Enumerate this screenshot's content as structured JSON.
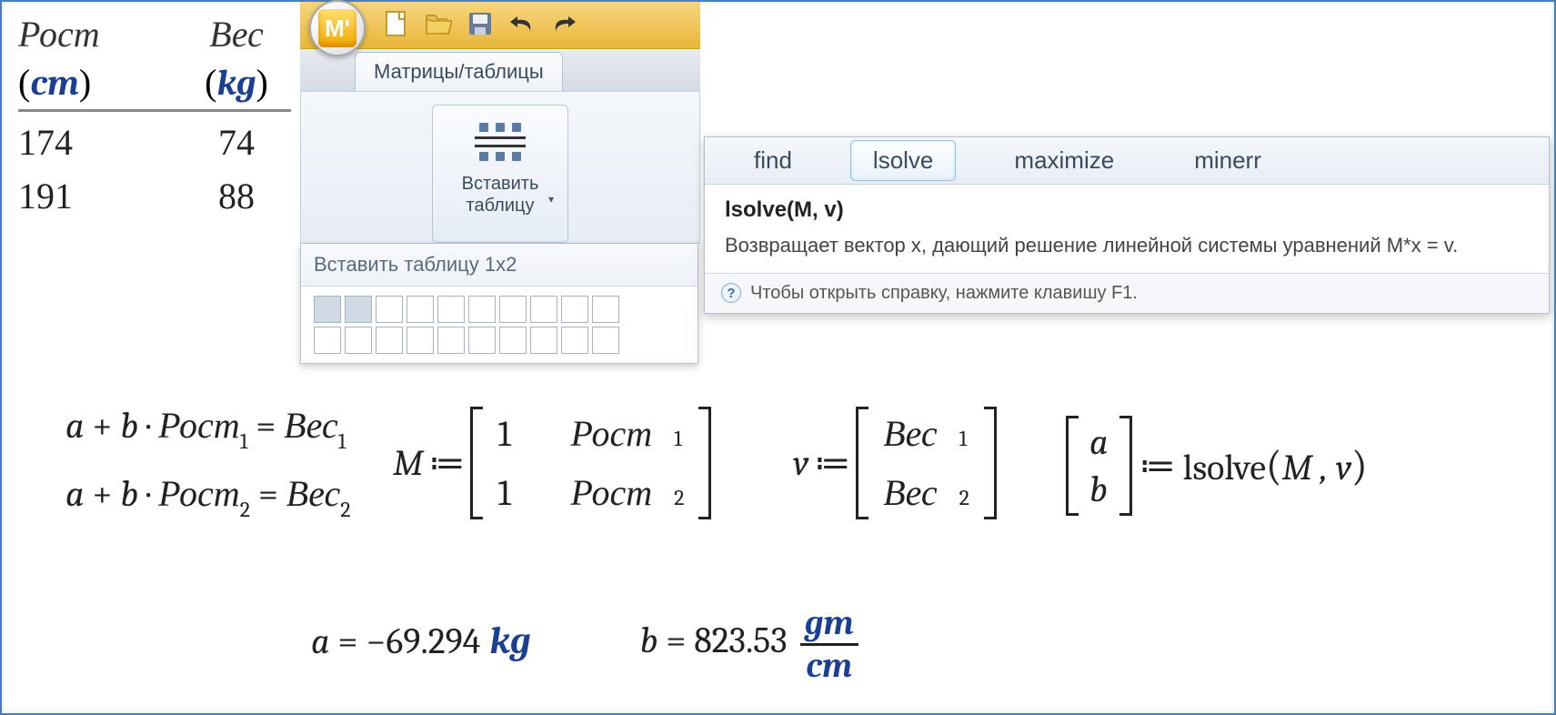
{
  "table": {
    "headers": [
      "Рост",
      "Вес"
    ],
    "units": [
      "cm",
      "kg"
    ],
    "rows": [
      [
        "174",
        "74"
      ],
      [
        "191",
        "88"
      ]
    ]
  },
  "ribbon": {
    "orb_letter": "M'",
    "tab_label": "Матрицы/таблицы",
    "insert_table_button": "Вставить таблицу",
    "insert_popup_title": "Вставить таблицу 1x2"
  },
  "help": {
    "tabs": [
      "find",
      "lsolve",
      "maximize",
      "minerr"
    ],
    "selected": "lsolve",
    "signature": "lsolve(M, v)",
    "description": "Возвращает вектор x, дающий решение линейной системы уравнений M*x = v.",
    "footer": "Чтобы открыть справку, нажмите клавишу F1."
  },
  "equations": {
    "line1_pre": "a + b · ",
    "var_height": "Рост",
    "eq": " = ",
    "var_weight": "Вес",
    "M_label": "M",
    "assign": " ≔ ",
    "v_label": "v",
    "ab_a": "a",
    "ab_b": "b",
    "lsolve_call": "lsolve",
    "lsolve_args": "M , v",
    "one": "1"
  },
  "results": {
    "a_label": "a",
    "a_val": "−69.294",
    "a_unit": "kg",
    "b_label": "b",
    "b_val": "823.53",
    "b_unit_num": "gm",
    "b_unit_den": "cm"
  },
  "paren_open": "(",
  "paren_close": ")"
}
